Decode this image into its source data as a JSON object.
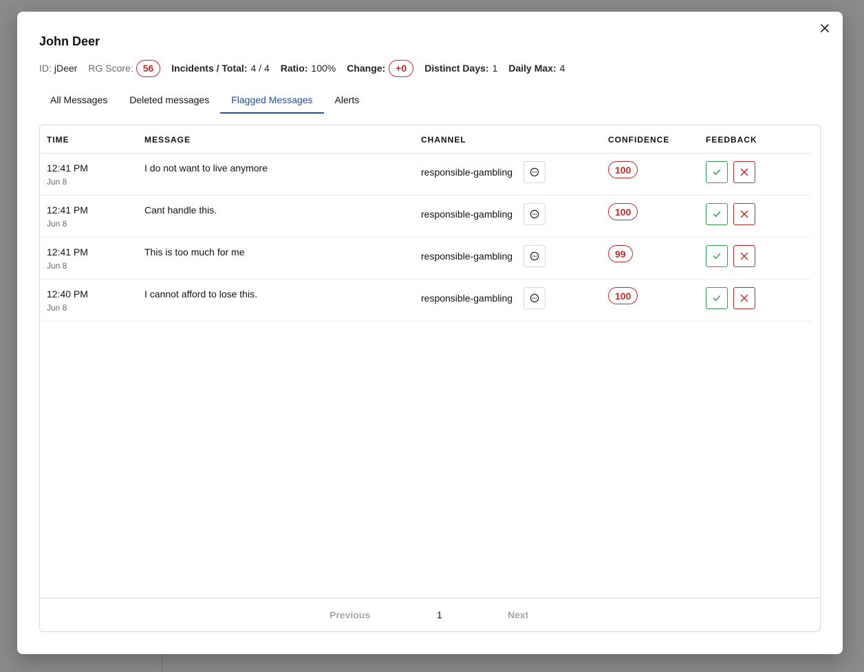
{
  "modal": {
    "title": "John Deer",
    "stats": {
      "id_label": "ID:",
      "id_value": "jDeer",
      "rg_label": "RG Score:",
      "rg_value": "56",
      "incidents_label": "Incidents / Total:",
      "incidents_value": "4 / 4",
      "ratio_label": "Ratio:",
      "ratio_value": "100%",
      "change_label": "Change:",
      "change_value": "+0",
      "days_label": "Distinct Days:",
      "days_value": "1",
      "max_label": "Daily Max:",
      "max_value": "4"
    },
    "tabs": [
      {
        "label": "All Messages"
      },
      {
        "label": "Deleted messages"
      },
      {
        "label": "Flagged Messages",
        "active": true
      },
      {
        "label": "Alerts"
      }
    ]
  },
  "table": {
    "headers": {
      "time": "TIME",
      "message": "MESSAGE",
      "channel": "CHANNEL",
      "confidence": "CONFIDENCE",
      "feedback": "FEEDBACK"
    },
    "rows": [
      {
        "time": "12:41 PM",
        "date": "Jun 8",
        "message": "I do not want to live anymore",
        "channel": "responsible-gambling",
        "confidence": "100"
      },
      {
        "time": "12:41 PM",
        "date": "Jun 8",
        "message": "Cant handle this.",
        "channel": "responsible-gambling",
        "confidence": "100"
      },
      {
        "time": "12:41 PM",
        "date": "Jun 8",
        "message": "This is too much for me",
        "channel": "responsible-gambling",
        "confidence": "99"
      },
      {
        "time": "12:40 PM",
        "date": "Jun 8",
        "message": "I cannot afford to lose this.",
        "channel": "responsible-gambling",
        "confidence": "100"
      }
    ]
  },
  "pager": {
    "previous": "Previous",
    "page": "1",
    "next": "Next"
  },
  "colors": {
    "accent": "#1e4fa3",
    "danger": "#c62828",
    "success": "#2e9e4a"
  },
  "icons": {
    "close": "close-icon",
    "chat": "chat-bubble-icon",
    "approve": "checkmark-icon",
    "reject": "x-icon"
  }
}
